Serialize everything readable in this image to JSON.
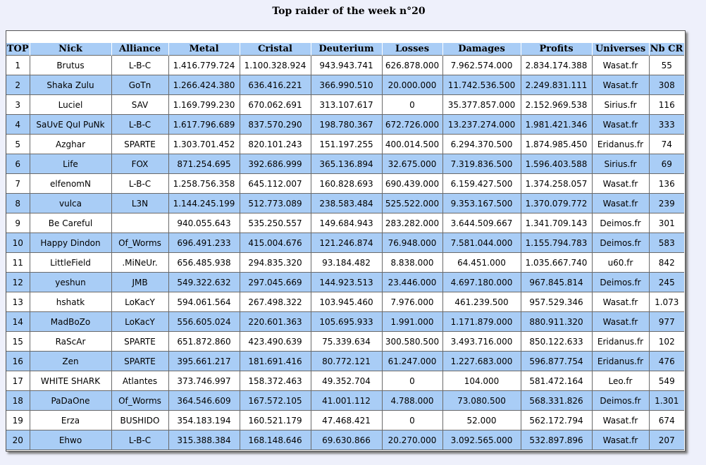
{
  "page": {
    "title": "Top raider of the week n°20"
  },
  "colors": {
    "header_bg": "#a9cdf6",
    "row_alt_bg": "#a9cdf6",
    "row_bg": "#ffffff",
    "page_bg": "#eef0fb"
  },
  "table": {
    "headers": [
      "TOP",
      "Nick",
      "Alliance",
      "Metal",
      "Cristal",
      "Deuterium",
      "Losses",
      "Damages",
      "Profits",
      "Universes",
      "Nb CR"
    ],
    "rows": [
      [
        "1",
        "Brutus",
        "L-B-C",
        "1.416.779.724",
        "1.100.328.924",
        "943.943.741",
        "626.878.000",
        "7.962.574.000",
        "2.834.174.388",
        "Wasat.fr",
        "55"
      ],
      [
        "2",
        "Shaka Zulu",
        "GoTn",
        "1.266.424.380",
        "636.416.221",
        "366.990.510",
        "20.000.000",
        "11.742.536.500",
        "2.249.831.111",
        "Wasat.fr",
        "308"
      ],
      [
        "3",
        "Luciel",
        "SAV",
        "1.169.799.230",
        "670.062.691",
        "313.107.617",
        "0",
        "35.377.857.000",
        "2.152.969.538",
        "Sirius.fr",
        "116"
      ],
      [
        "4",
        "SaUvE QuI PuNk",
        "L-B-C",
        "1.617.796.689",
        "837.570.290",
        "198.780.367",
        "672.726.000",
        "13.237.274.000",
        "1.981.421.346",
        "Wasat.fr",
        "333"
      ],
      [
        "5",
        "Azghar",
        "SPARTE",
        "1.303.701.452",
        "820.101.243",
        "151.197.255",
        "400.014.500",
        "6.294.370.500",
        "1.874.985.450",
        "Eridanus.fr",
        "74"
      ],
      [
        "6",
        "Life",
        "FOX",
        "871.254.695",
        "392.686.999",
        "365.136.894",
        "32.675.000",
        "7.319.836.500",
        "1.596.403.588",
        "Sirius.fr",
        "69"
      ],
      [
        "7",
        "elfenomN",
        "L-B-C",
        "1.258.756.358",
        "645.112.007",
        "160.828.693",
        "690.439.000",
        "6.159.427.500",
        "1.374.258.057",
        "Wasat.fr",
        "136"
      ],
      [
        "8",
        "vulca",
        "L3N",
        "1.144.245.199",
        "512.773.089",
        "238.583.484",
        "525.522.000",
        "9.353.167.500",
        "1.370.079.772",
        "Wasat.fr",
        "239"
      ],
      [
        "9",
        "Be Careful",
        "",
        "940.055.643",
        "535.250.557",
        "149.684.943",
        "283.282.000",
        "3.644.509.667",
        "1.341.709.143",
        "Deimos.fr",
        "301"
      ],
      [
        "10",
        "Happy Dindon",
        "Of_Worms",
        "696.491.233",
        "415.004.676",
        "121.246.874",
        "76.948.000",
        "7.581.044.000",
        "1.155.794.783",
        "Deimos.fr",
        "583"
      ],
      [
        "11",
        "LittleField",
        ".MiNeUr.",
        "656.485.938",
        "294.835.320",
        "93.184.482",
        "8.838.000",
        "64.451.000",
        "1.035.667.740",
        "u60.fr",
        "842"
      ],
      [
        "12",
        "yeshun",
        "JMB",
        "549.322.632",
        "297.045.669",
        "144.923.513",
        "23.446.000",
        "4.697.180.000",
        "967.845.814",
        "Deimos.fr",
        "245"
      ],
      [
        "13",
        "hshatk",
        "LoKacY",
        "594.061.564",
        "267.498.322",
        "103.945.460",
        "7.976.000",
        "461.239.500",
        "957.529.346",
        "Wasat.fr",
        "1.073"
      ],
      [
        "14",
        "MadBoZo",
        "LoKacY",
        "556.605.024",
        "220.601.363",
        "105.695.933",
        "1.991.000",
        "1.171.879.000",
        "880.911.320",
        "Wasat.fr",
        "977"
      ],
      [
        "15",
        "RaScAr",
        "SPARTE",
        "651.872.860",
        "423.490.639",
        "75.339.634",
        "300.580.500",
        "3.493.716.000",
        "850.122.633",
        "Eridanus.fr",
        "102"
      ],
      [
        "16",
        "Zen",
        "SPARTE",
        "395.661.217",
        "181.691.416",
        "80.772.121",
        "61.247.000",
        "1.227.683.000",
        "596.877.754",
        "Eridanus.fr",
        "476"
      ],
      [
        "17",
        "WHITE SHARK",
        "Atlantes",
        "373.746.997",
        "158.372.463",
        "49.352.704",
        "0",
        "104.000",
        "581.472.164",
        "Leo.fr",
        "549"
      ],
      [
        "18",
        "PaDaOne",
        "Of_Worms",
        "364.546.609",
        "167.572.105",
        "41.001.112",
        "4.788.000",
        "73.080.500",
        "568.331.826",
        "Deimos.fr",
        "1.301"
      ],
      [
        "19",
        "Erza",
        "BUSHIDO",
        "354.183.194",
        "160.521.179",
        "47.468.421",
        "0",
        "52.000",
        "562.172.794",
        "Wasat.fr",
        "674"
      ],
      [
        "20",
        "Ehwo",
        "L-B-C",
        "315.388.384",
        "168.148.646",
        "69.630.866",
        "20.270.000",
        "3.092.565.000",
        "532.897.896",
        "Wasat.fr",
        "207"
      ]
    ]
  }
}
